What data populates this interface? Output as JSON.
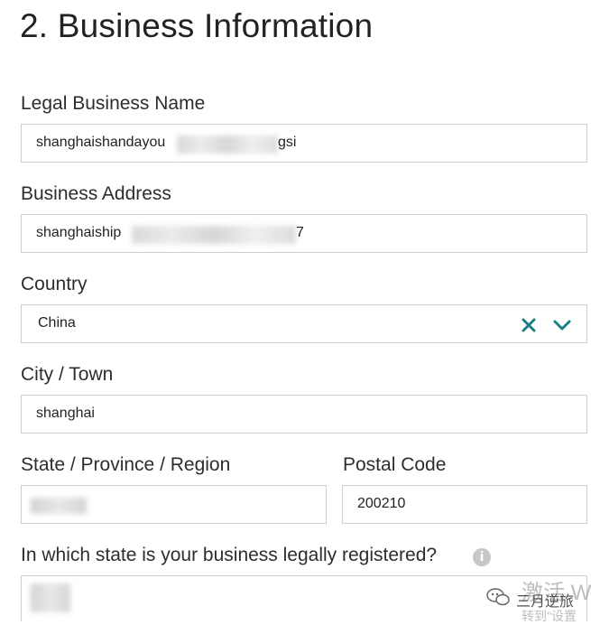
{
  "section_title": "2. Business Information",
  "legal_name": {
    "label": "Legal Business Name",
    "value_start": "shanghaishandayou",
    "value_end": "gsi"
  },
  "address": {
    "label": "Business Address",
    "value_start": "shanghaiship",
    "value_end": "7"
  },
  "country": {
    "label": "Country",
    "value": "China"
  },
  "city": {
    "label": "City / Town",
    "value": "shanghai"
  },
  "state": {
    "label": "State / Province / Region",
    "value": ""
  },
  "postal": {
    "label": "Postal Code",
    "value": "200210"
  },
  "registered_state": {
    "label": "In which state is your business legally registered?",
    "value": ""
  },
  "watermark": {
    "line1": "三月逆旅",
    "line2": "转到\"设置",
    "line3": "激活 W"
  },
  "colors": {
    "accent": "#1a7f86",
    "border": "#cfcfcf"
  }
}
